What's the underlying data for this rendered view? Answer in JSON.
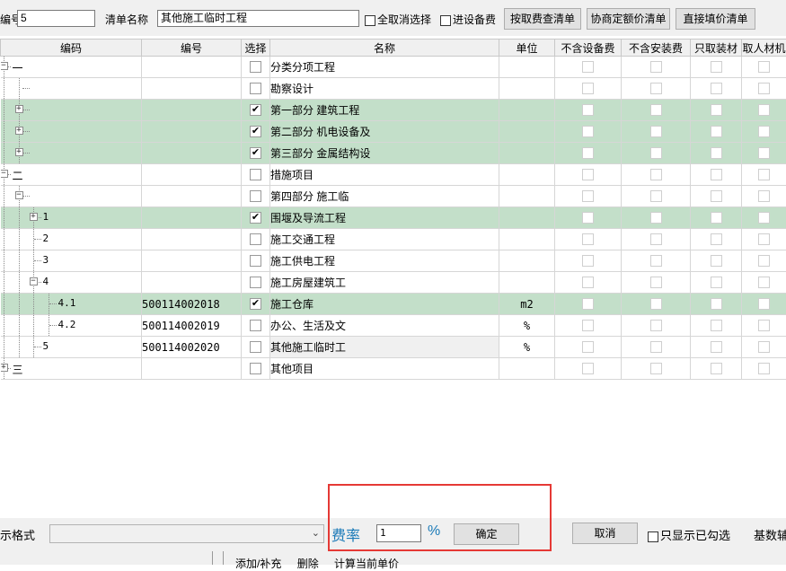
{
  "toolbar": {
    "code_label": "编号",
    "code_value": "5",
    "name_label": "清单名称",
    "name_value": "其他施工临时工程",
    "check_cancel_all": "全取消选择",
    "check_equipment_fee": "进设备费",
    "btn_by_fee": "按取费查清单",
    "btn_negotiated": "协商定额价清单",
    "btn_direct": "直接填价清单"
  },
  "columns": [
    "编码",
    "编号",
    "选择",
    "名称",
    "单位",
    "不含设备费",
    "不含安装费",
    "只取装材",
    "取人材机"
  ],
  "rows": [
    {
      "code": "一",
      "number": "",
      "selected": false,
      "name": "分类分项工程",
      "unit": "",
      "highlighted": false
    },
    {
      "code": "",
      "number": "",
      "selected": false,
      "name": "勘察设计",
      "unit": "",
      "highlighted": false
    },
    {
      "code": "",
      "number": "",
      "selected": true,
      "name": "第一部分  建筑工程",
      "unit": "",
      "highlighted": true
    },
    {
      "code": "",
      "number": "",
      "selected": true,
      "name": "第二部分  机电设备及",
      "unit": "",
      "highlighted": true
    },
    {
      "code": "",
      "number": "",
      "selected": true,
      "name": "第三部分  金属结构设",
      "unit": "",
      "highlighted": true
    },
    {
      "code": "二",
      "number": "",
      "selected": false,
      "name": "措施项目",
      "unit": "",
      "highlighted": false
    },
    {
      "code": "",
      "number": "",
      "selected": false,
      "name": "第四部分  施工临",
      "unit": "",
      "highlighted": false
    },
    {
      "code": "1",
      "number": "",
      "selected": true,
      "name": "围堰及导流工程",
      "unit": "",
      "highlighted": true
    },
    {
      "code": "2",
      "number": "",
      "selected": false,
      "name": "施工交通工程",
      "unit": "",
      "highlighted": false
    },
    {
      "code": "3",
      "number": "",
      "selected": false,
      "name": "施工供电工程",
      "unit": "",
      "highlighted": false
    },
    {
      "code": "4",
      "number": "",
      "selected": false,
      "name": "施工房屋建筑工",
      "unit": "",
      "highlighted": false
    },
    {
      "code": "4.1",
      "number": "500114002018",
      "selected": true,
      "name": "施工仓库",
      "unit": "m2",
      "highlighted": true
    },
    {
      "code": "4.2",
      "number": "500114002019",
      "selected": false,
      "name": "办公、生活及文",
      "unit": "%",
      "highlighted": false
    },
    {
      "code": "5",
      "number": "500114002020",
      "selected": false,
      "name": "其他施工临时工",
      "unit": "%",
      "highlighted": false,
      "gray": true
    },
    {
      "code": "三",
      "number": "",
      "selected": false,
      "name": "其他项目",
      "unit": "",
      "highlighted": false
    }
  ],
  "bottom": {
    "format_label": "示格式",
    "format_value": "",
    "rate_label": "费率",
    "rate_value": "1",
    "percent_sign": "%",
    "confirm": "确定",
    "cancel": "取消",
    "show_checked_only": "只显示已勾选",
    "right_label": "基数辅",
    "links": [
      "添加/补充",
      "删除",
      "计算当前单价"
    ]
  },
  "colors": {
    "highlight_row": "#c3dfc9",
    "rate_text": "#1a7ab8",
    "annotation_box": "#e53935"
  }
}
